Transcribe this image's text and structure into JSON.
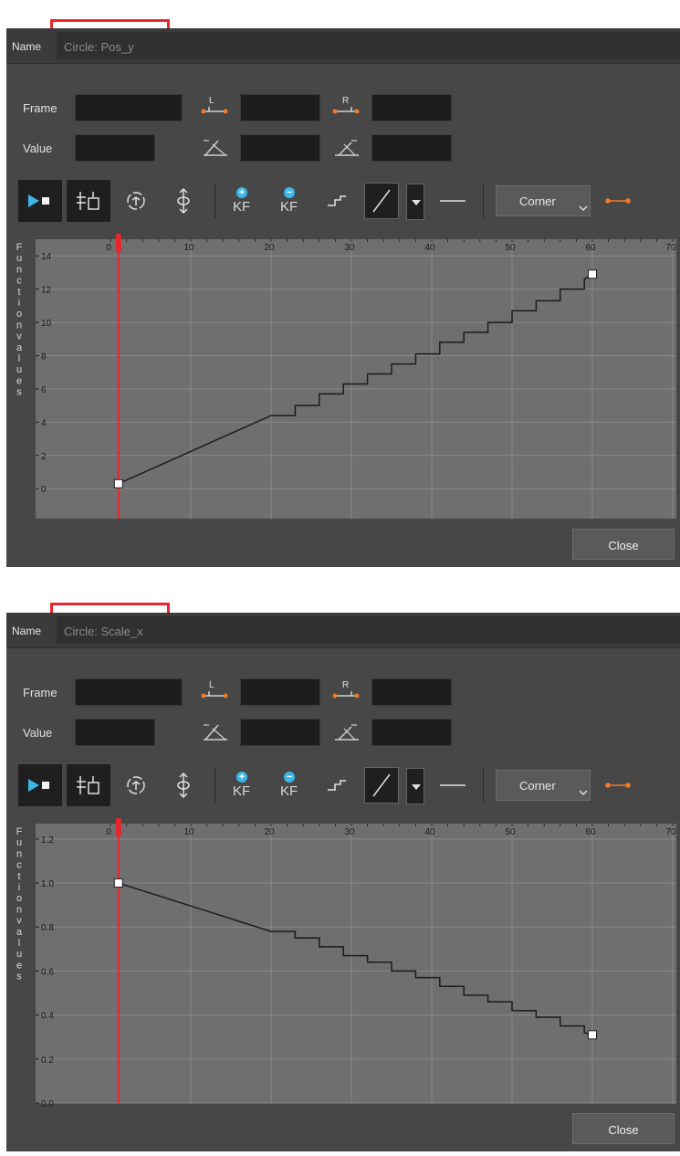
{
  "dialogs": [
    {
      "name_label": "Name",
      "name_value": "Circle: Pos_y",
      "frame_label": "Frame",
      "value_label": "Value",
      "left_handle_label": "L",
      "right_handle_label": "R",
      "keyframe_add_label": "KF",
      "keyframe_remove_label": "KF",
      "interpolation_dropdown_value": "Corner",
      "close_label": "Close",
      "y_axis_label": "Function values",
      "chart_data": {
        "type": "line",
        "xlim": [
          0,
          70
        ],
        "ylim": [
          -1.8,
          15
        ],
        "x_ticks": [
          "0",
          "10",
          "20",
          "30",
          "40",
          "50",
          "60",
          "70"
        ],
        "y_ticks": [
          "0",
          "2",
          "4",
          "6",
          "8",
          "10",
          "12",
          "14"
        ],
        "y_tick_values": [
          0,
          2,
          4,
          6,
          8,
          10,
          12,
          14
        ],
        "current_frame": 1,
        "keyframes": [
          {
            "x": 1,
            "y": 0.3
          },
          {
            "x": 60,
            "y": 12.9
          }
        ],
        "curve": [
          [
            1,
            0.3
          ],
          [
            20,
            4.4
          ],
          [
            23,
            4.4
          ],
          [
            23,
            5.0
          ],
          [
            26,
            5.0
          ],
          [
            26,
            5.7
          ],
          [
            29,
            5.7
          ],
          [
            29,
            6.3
          ],
          [
            32,
            6.3
          ],
          [
            32,
            6.9
          ],
          [
            35,
            6.9
          ],
          [
            35,
            7.5
          ],
          [
            38,
            7.5
          ],
          [
            38,
            8.1
          ],
          [
            41,
            8.1
          ],
          [
            41,
            8.8
          ],
          [
            44,
            8.8
          ],
          [
            44,
            9.4
          ],
          [
            47,
            9.4
          ],
          [
            47,
            10.0
          ],
          [
            50,
            10.0
          ],
          [
            50,
            10.7
          ],
          [
            53,
            10.7
          ],
          [
            53,
            11.3
          ],
          [
            56,
            11.3
          ],
          [
            56,
            12.0
          ],
          [
            59,
            12.0
          ],
          [
            59,
            12.6
          ],
          [
            60,
            12.9
          ]
        ]
      }
    },
    {
      "name_label": "Name",
      "name_value": "Circle: Scale_x",
      "frame_label": "Frame",
      "value_label": "Value",
      "left_handle_label": "L",
      "right_handle_label": "R",
      "keyframe_add_label": "KF",
      "keyframe_remove_label": "KF",
      "interpolation_dropdown_value": "Corner",
      "close_label": "Close",
      "y_axis_label": "Function values",
      "chart_data": {
        "type": "line",
        "xlim": [
          0,
          70
        ],
        "ylim": [
          0,
          1.27
        ],
        "x_ticks": [
          "0",
          "10",
          "20",
          "30",
          "40",
          "50",
          "60",
          "70"
        ],
        "y_ticks": [
          "0.0",
          "0.2",
          "0.4",
          "0.6",
          "0.8",
          "1.0",
          "1.2"
        ],
        "y_tick_values": [
          0,
          0.2,
          0.4,
          0.6,
          0.8,
          1.0,
          1.2
        ],
        "current_frame": 1,
        "keyframes": [
          {
            "x": 1,
            "y": 1.0
          },
          {
            "x": 60,
            "y": 0.31
          }
        ],
        "curve": [
          [
            1,
            1.0
          ],
          [
            20,
            0.78
          ],
          [
            23,
            0.78
          ],
          [
            23,
            0.75
          ],
          [
            26,
            0.75
          ],
          [
            26,
            0.71
          ],
          [
            29,
            0.71
          ],
          [
            29,
            0.67
          ],
          [
            32,
            0.67
          ],
          [
            32,
            0.64
          ],
          [
            35,
            0.64
          ],
          [
            35,
            0.6
          ],
          [
            38,
            0.6
          ],
          [
            38,
            0.57
          ],
          [
            41,
            0.57
          ],
          [
            41,
            0.53
          ],
          [
            44,
            0.53
          ],
          [
            44,
            0.49
          ],
          [
            47,
            0.49
          ],
          [
            47,
            0.46
          ],
          [
            50,
            0.46
          ],
          [
            50,
            0.42
          ],
          [
            53,
            0.42
          ],
          [
            53,
            0.39
          ],
          [
            56,
            0.39
          ],
          [
            56,
            0.35
          ],
          [
            59,
            0.35
          ],
          [
            59,
            0.32
          ],
          [
            60,
            0.31
          ]
        ]
      }
    }
  ]
}
